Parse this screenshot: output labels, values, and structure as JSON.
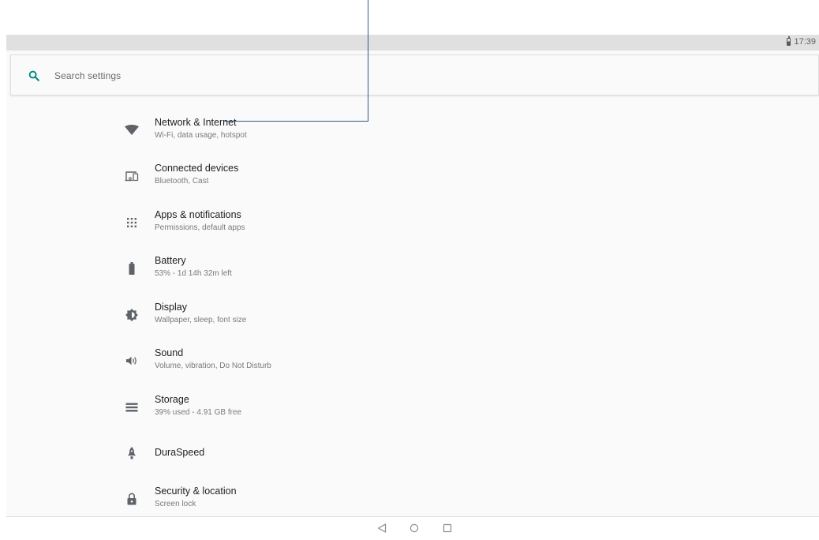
{
  "status_bar": {
    "time": "17:39",
    "battery_level": 0.55
  },
  "search": {
    "placeholder": "Search settings",
    "icon": "search-icon",
    "accent_color": "#00897b"
  },
  "settings": {
    "items": [
      {
        "id": "network",
        "title": "Network & Internet",
        "subtitle": "Wi-Fi, data usage, hotspot",
        "icon": "wifi-icon"
      },
      {
        "id": "connected",
        "title": "Connected devices",
        "subtitle": "Bluetooth, Cast",
        "icon": "devices-icon"
      },
      {
        "id": "apps",
        "title": "Apps & notifications",
        "subtitle": "Permissions, default apps",
        "icon": "apps-grid-icon"
      },
      {
        "id": "battery",
        "title": "Battery",
        "subtitle": "53% - 1d 14h 32m left",
        "icon": "battery-icon"
      },
      {
        "id": "display",
        "title": "Display",
        "subtitle": "Wallpaper, sleep, font size",
        "icon": "brightness-icon"
      },
      {
        "id": "sound",
        "title": "Sound",
        "subtitle": "Volume, vibration, Do Not Disturb",
        "icon": "volume-icon"
      },
      {
        "id": "storage",
        "title": "Storage",
        "subtitle": "39% used - 4.91 GB free",
        "icon": "storage-icon"
      },
      {
        "id": "duraspeed",
        "title": "DuraSpeed",
        "subtitle": "",
        "icon": "rocket-icon"
      },
      {
        "id": "security",
        "title": "Security & location",
        "subtitle": "Screen lock",
        "icon": "lock-icon"
      }
    ]
  },
  "nav": {
    "back": "back-icon",
    "home": "home-icon",
    "recents": "recents-icon"
  },
  "colors": {
    "icon": "#5f6368",
    "callout": "#2e5b8a"
  }
}
